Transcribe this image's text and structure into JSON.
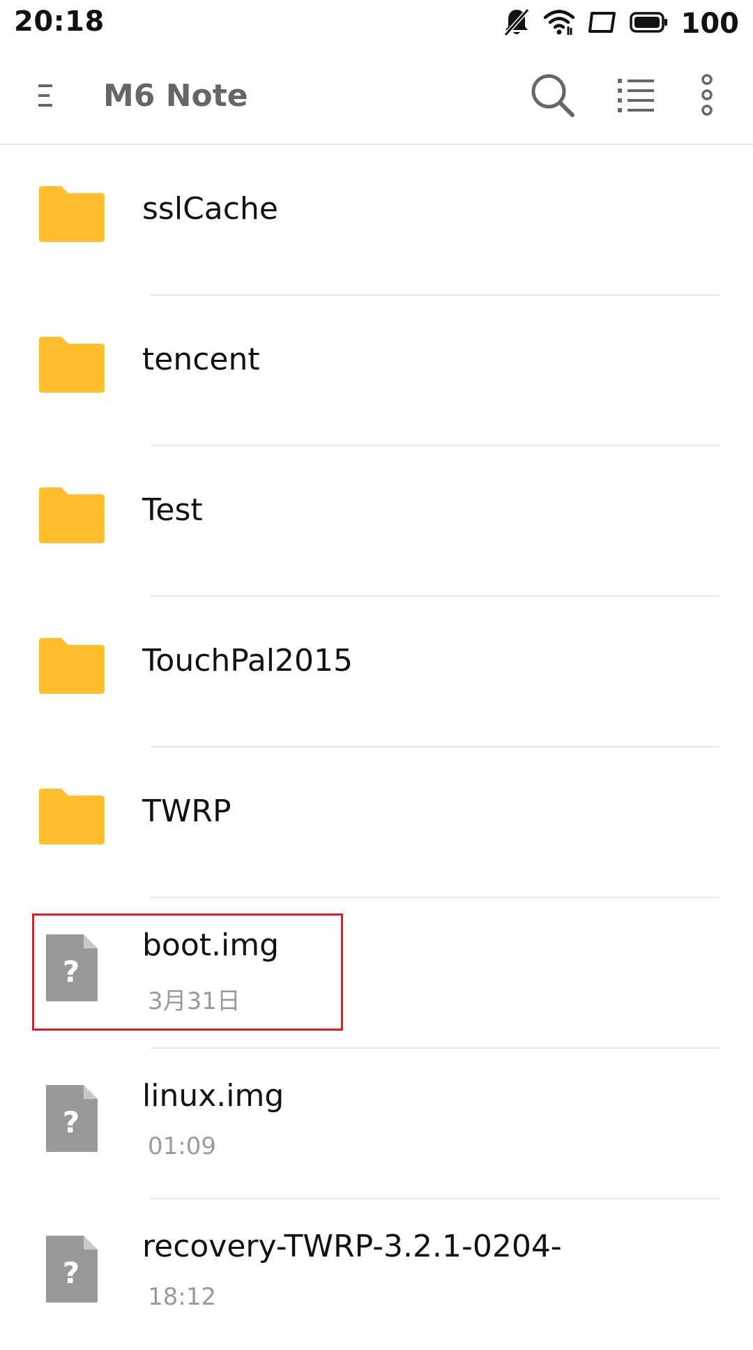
{
  "status": {
    "time": "20:18",
    "battery": "100",
    "icons": [
      "mute-icon",
      "wifi-icon",
      "screen-icon",
      "battery-icon"
    ]
  },
  "toolbar": {
    "title": "M6 Note",
    "icons": [
      "menu-icon",
      "search-icon",
      "list-view-icon",
      "more-icon"
    ]
  },
  "colors": {
    "folder": "#FFBE2E",
    "unknown_file": "#999999",
    "highlight": "#D21F2A"
  },
  "items": [
    {
      "name": "sslCache",
      "type": "folder"
    },
    {
      "name": "tencent",
      "type": "folder"
    },
    {
      "name": "Test",
      "type": "folder"
    },
    {
      "name": "TouchPal2015",
      "type": "folder"
    },
    {
      "name": "TWRP",
      "type": "folder"
    },
    {
      "name": "boot.img",
      "type": "file",
      "meta": "3月31日",
      "highlighted": true
    },
    {
      "name": "linux.img",
      "type": "file",
      "meta": "01:09"
    },
    {
      "name": "recovery-TWRP-3.2.1-0204-",
      "type": "file",
      "meta": "18:12"
    }
  ]
}
